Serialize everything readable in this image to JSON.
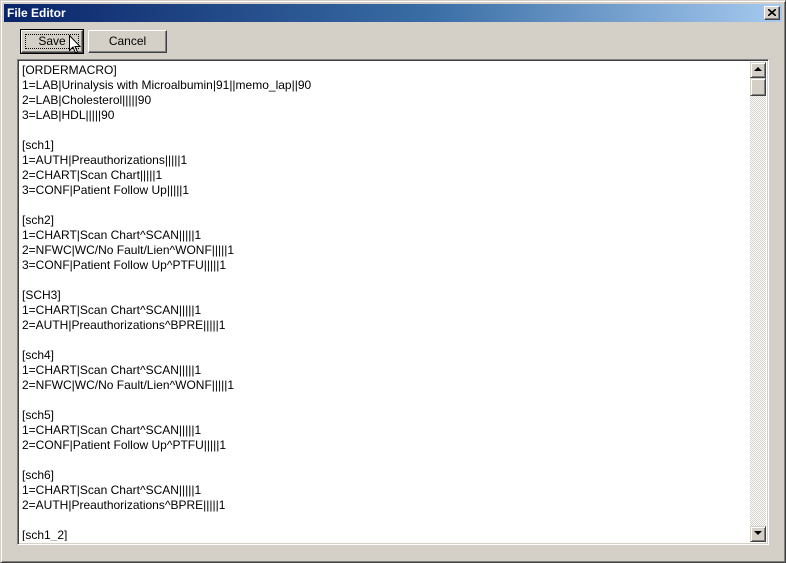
{
  "window": {
    "title": "File Editor"
  },
  "toolbar": {
    "save_label": "Save",
    "cancel_label": "Cancel"
  },
  "editor": {
    "lines": [
      "[ORDERMACRO]",
      "1=LAB|Urinalysis with Microalbumin|91||memo_lap||90",
      "2=LAB|Cholesterol|||||90",
      "3=LAB|HDL|||||90",
      "",
      "[sch1]",
      "1=AUTH|Preauthorizations|||||1",
      "2=CHART|Scan Chart|||||1",
      "3=CONF|Patient Follow Up|||||1",
      "",
      "[sch2]",
      "1=CHART|Scan Chart^SCAN|||||1",
      "2=NFWC|WC/No Fault/Lien^WONF|||||1",
      "3=CONF|Patient Follow Up^PTFU|||||1",
      "",
      "[SCH3]",
      "1=CHART|Scan Chart^SCAN|||||1",
      "2=AUTH|Preauthorizations^BPRE|||||1",
      "",
      "[sch4]",
      "1=CHART|Scan Chart^SCAN|||||1",
      "2=NFWC|WC/No Fault/Lien^WONF|||||1",
      "",
      "[sch5]",
      "1=CHART|Scan Chart^SCAN|||||1",
      "2=CONF|Patient Follow Up^PTFU|||||1",
      "",
      "[sch6]",
      "1=CHART|Scan Chart^SCAN|||||1",
      "2=AUTH|Preauthorizations^BPRE|||||1",
      "",
      "[sch1_2]"
    ]
  },
  "icons": {
    "close": "close-icon",
    "scroll_up": "arrow-up-icon",
    "scroll_down": "arrow-down-icon",
    "cursor": "mouse-pointer-icon"
  }
}
